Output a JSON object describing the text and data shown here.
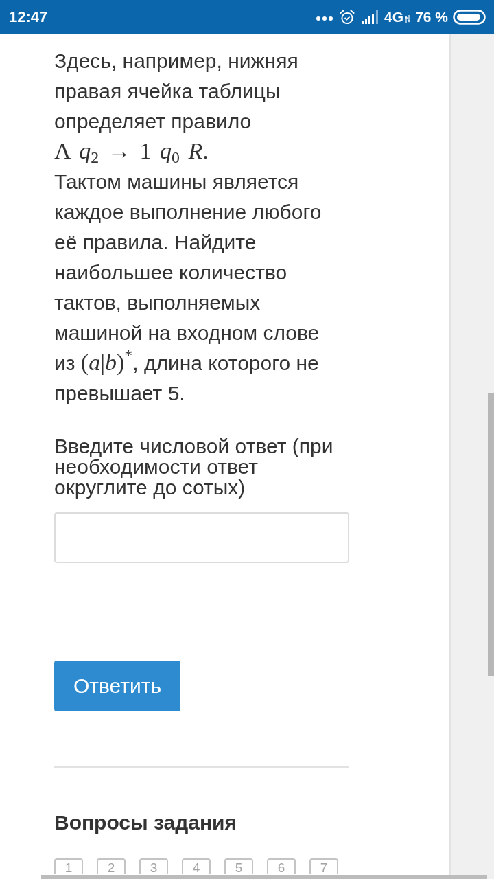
{
  "status_bar": {
    "time": "12:47",
    "network": "4G",
    "battery": "76 %"
  },
  "question": {
    "paragraphs": [
      [
        {
          "kind": "text",
          "text": "Здесь, например, нижняя правая ячейка таблицы определяет правило "
        },
        {
          "kind": "math",
          "text": "Λ *q*$_{2}$ → 1 *q*$_{0}$ *R*."
        }
      ],
      [
        {
          "kind": "text",
          "text": "Тактом машины является каждое выполнение любого её правила. Найдите наибольшее количество тактов, выполняемых машиной на входном слове из "
        },
        {
          "kind": "math",
          "text": "(*a*|*b*)$^{*}$"
        },
        {
          "kind": "text",
          "text": ", длина которого не превышает 5."
        }
      ]
    ]
  },
  "answer": {
    "prompt": "Введите числовой ответ (при необходимости ответ округлите до сотых)",
    "submit_button": "Ответить"
  },
  "task_questions": {
    "title": "Вопросы задания",
    "items": [
      "1",
      "2",
      "3",
      "4",
      "5",
      "6",
      "7"
    ]
  }
}
